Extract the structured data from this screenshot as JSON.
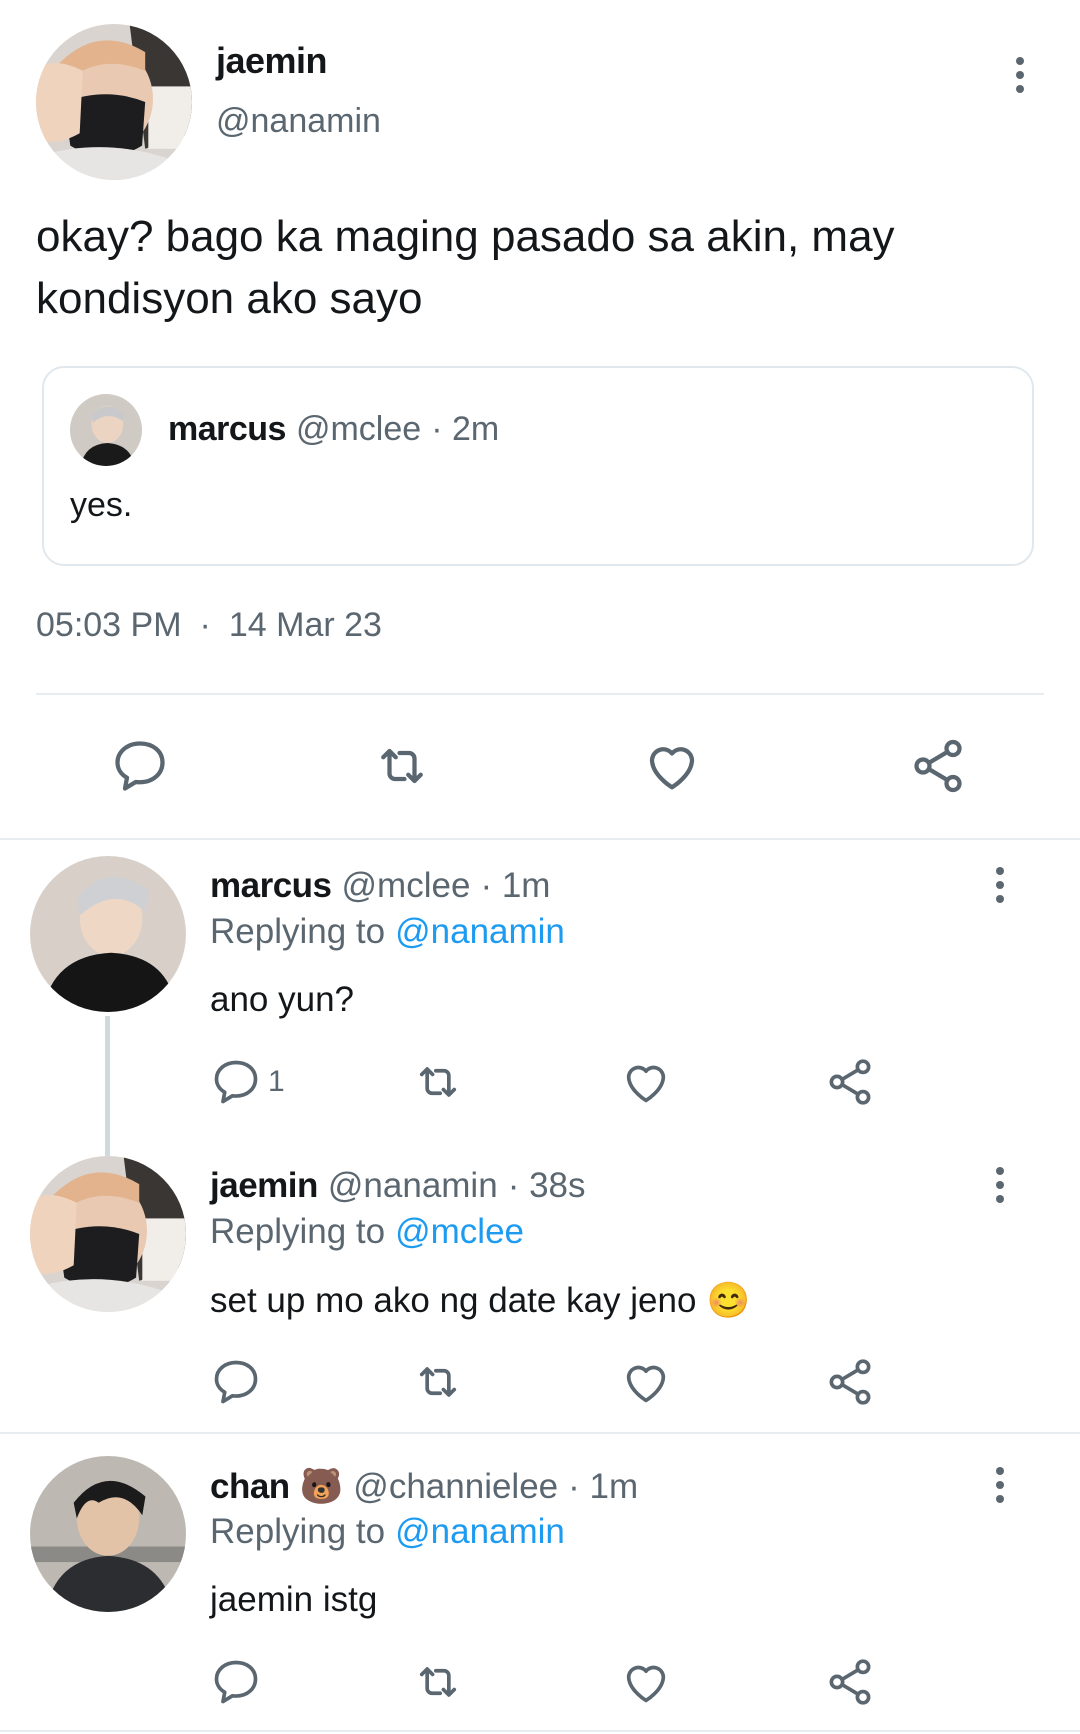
{
  "main_tweet": {
    "name": "jaemin",
    "handle": "@nanamin",
    "text_line1": "okay? bago ka maging pasado sa akin, may",
    "text_line2": "kondisyon ako sayo",
    "quoted": {
      "name": "marcus",
      "handle": "@mclee",
      "time": "· 2m",
      "text": "yes."
    },
    "time": "05:03 PM",
    "date_sep": "·",
    "date": "14 Mar 23"
  },
  "replies": [
    {
      "name": "marcus",
      "handle": "@mclee",
      "time": "· 1m",
      "replying_label": "Replying to",
      "replying_to": "@nanamin",
      "text": "ano yun?",
      "reply_count": "1"
    },
    {
      "name": "jaemin",
      "handle": "@nanamin",
      "time": "· 38s",
      "replying_label": "Replying to",
      "replying_to": "@mclee",
      "text": "set up mo ako ng date kay jeno",
      "emoji": "😊"
    },
    {
      "name": "chan",
      "name_emoji": "🐻",
      "handle": "@channielee",
      "time": "· 1m",
      "replying_label": "Replying to",
      "replying_to": "@nanamin",
      "text": "jaemin istg"
    }
  ],
  "icons": [
    "more-vertical-icon",
    "reply-icon",
    "retweet-icon",
    "like-icon",
    "share-icon"
  ],
  "colors": {
    "link": "#1d9bf0",
    "muted": "#5b6770",
    "text": "#14171a",
    "divider": "#e6ecf0"
  }
}
